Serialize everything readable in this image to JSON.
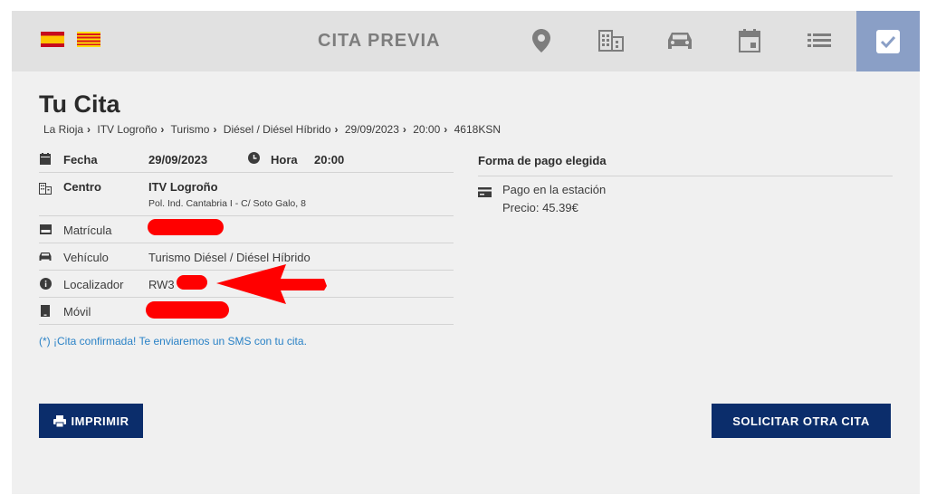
{
  "header": {
    "title": "CITA PREVIA",
    "languages": [
      {
        "name": "es-flag-icon",
        "label": "Español"
      },
      {
        "name": "ca-flag-icon",
        "label": "Català"
      }
    ],
    "steps": [
      "location-icon",
      "building-icon",
      "car-icon",
      "calendar-icon",
      "list-icon",
      "checkbox-icon"
    ],
    "active_step": "checkbox-icon"
  },
  "page": {
    "title": "Tu Cita",
    "breadcrumb": [
      "La Rioja",
      "ITV Logroño",
      "Turismo",
      "Diésel / Diésel Híbrido",
      "29/09/2023",
      "20:00",
      "4618KSN"
    ]
  },
  "details": {
    "fecha_label": "Fecha",
    "fecha_value": "29/09/2023",
    "hora_label": "Hora",
    "hora_value": "20:00",
    "centro_label": "Centro",
    "centro_value": "ITV Logroño",
    "centro_address": "Pol. Ind. Cantabria I - C/ Soto Galo, 8",
    "matricula_label": "Matrícula",
    "vehiculo_label": "Vehículo",
    "vehiculo_value": "Turismo Diésel / Diésel Híbrido",
    "localizador_label": "Localizador",
    "localizador_value": "RW3",
    "movil_label": "Móvil"
  },
  "confirmation": "(*) ¡Cita confirmada! Te enviaremos un SMS con tu cita.",
  "payment": {
    "heading": "Forma de pago elegida",
    "method": "Pago en la estación",
    "price": "Precio: 45.39€"
  },
  "buttons": {
    "print": "IMPRIMIR",
    "new": "SOLICITAR OTRA CITA"
  },
  "colors": {
    "topbar": "#e1e1e1",
    "active_step": "#8a9fc6",
    "button": "#0b2d6b",
    "link": "#2a82c6",
    "redaction": "#ff0000"
  }
}
